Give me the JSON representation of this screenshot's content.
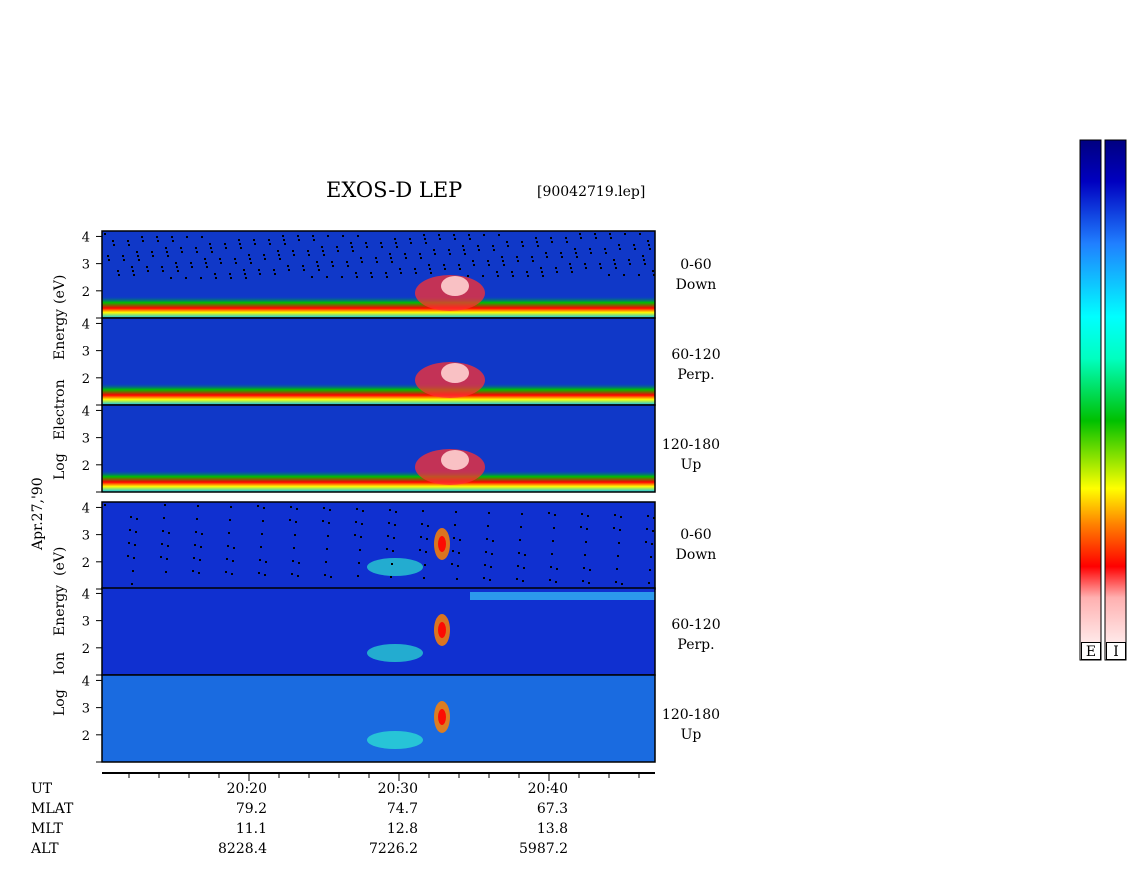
{
  "chart_data": {
    "type": "heatmap",
    "title": "EXOS-D LEP",
    "file": "[90042719.lep]",
    "date_label": "Apr.27,'90",
    "ytick_labels": [
      "4",
      "3",
      "2"
    ],
    "electron_ylabel": [
      "Log",
      "Electron",
      "Energy",
      "(eV)"
    ],
    "ion_ylabel": [
      "Log",
      "Ion",
      "Energy",
      "(eV)"
    ],
    "panels": [
      {
        "species": "Electron",
        "range": "0-60",
        "direction": "Down"
      },
      {
        "species": "Electron",
        "range": "60-120",
        "direction": "Perp."
      },
      {
        "species": "Electron",
        "range": "120-180",
        "direction": "Up"
      },
      {
        "species": "Ion",
        "range": "0-60",
        "direction": "Down"
      },
      {
        "species": "Ion",
        "range": "60-120",
        "direction": "Perp."
      },
      {
        "species": "Ion",
        "range": "120-180",
        "direction": "Up"
      }
    ],
    "ylim": [
      1,
      4.2
    ],
    "x_labels": {
      "UT": [
        "20:20",
        "20:30",
        "20:40"
      ],
      "MLAT": [
        "79.2",
        "74.7",
        "67.3"
      ],
      "MLT": [
        "11.1",
        "12.8",
        "13.8"
      ],
      "ALT": [
        "8228.4",
        "7226.2",
        "5987.2"
      ]
    },
    "row_names": [
      "UT",
      "MLAT",
      "MLT",
      "ALT"
    ],
    "colorbar_labels": [
      "E",
      "I"
    ],
    "colorscale": [
      "#ffffff",
      "#ffb0b0",
      "#ff0000",
      "#ff8000",
      "#ffff00",
      "#00c000",
      "#00ffc0",
      "#00ffff",
      "#2080ff",
      "#0000c0",
      "#000080"
    ]
  }
}
